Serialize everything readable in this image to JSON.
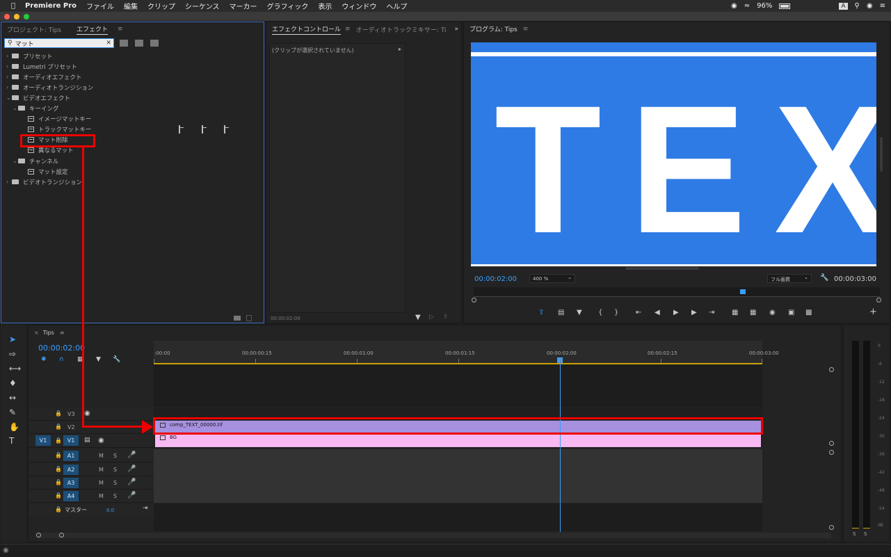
{
  "menubar": {
    "app": "Premiere Pro",
    "items": [
      "ファイル",
      "編集",
      "クリップ",
      "シーケンス",
      "マーカー",
      "グラフィック",
      "表示",
      "ウィンドウ",
      "ヘルプ"
    ],
    "battery": "96%",
    "input_badge": "A"
  },
  "effects_panel": {
    "tabs": [
      "プロジェクト: Tips",
      "エフェクト"
    ],
    "search_value": "マット",
    "tree": [
      {
        "label": "プリセット",
        "level": 0,
        "kind": "folder"
      },
      {
        "label": "Lumetri プリセット",
        "level": 0,
        "kind": "folder"
      },
      {
        "label": "オーディオエフェクト",
        "level": 0,
        "kind": "folder"
      },
      {
        "label": "オーディオトランジション",
        "level": 0,
        "kind": "folder"
      },
      {
        "label": "ビデオエフェクト",
        "level": 0,
        "kind": "folder",
        "open": true
      },
      {
        "label": "キーイング",
        "level": 1,
        "kind": "folder",
        "open": true
      },
      {
        "label": "イメージマットキー",
        "level": 2,
        "kind": "fx"
      },
      {
        "label": "トラックマットキー",
        "level": 2,
        "kind": "fx"
      },
      {
        "label": "マット削除",
        "level": 2,
        "kind": "fx"
      },
      {
        "label": "異なるマット",
        "level": 2,
        "kind": "fx"
      },
      {
        "label": "チャンネル",
        "level": 1,
        "kind": "folder",
        "open": true
      },
      {
        "label": "マット設定",
        "level": 2,
        "kind": "fx"
      },
      {
        "label": "ビデオトランジション",
        "level": 0,
        "kind": "folder"
      }
    ]
  },
  "effect_controls": {
    "tabs": [
      "エフェクトコントロール",
      "オーディオトラックミキサー: Ti"
    ],
    "empty_text": "(クリップが選択されていません)",
    "timecode": "00:00:02:00"
  },
  "program_monitor": {
    "title": "プログラム: Tips",
    "frame_text": "TEX",
    "frame_color": "#2f7be5",
    "timecode": "00:00:02:00",
    "zoom": "400 %",
    "quality": "フル画質",
    "duration": "00:00:03:00"
  },
  "timeline": {
    "sequence": "Tips",
    "timecode": "00:00:02:00",
    "ruler": [
      ":00:00",
      "00:00:00:15",
      "00:00:01:00",
      "00:00:01:15",
      "00:00:02:00",
      "00:00:02:15",
      "00:00:03:00"
    ],
    "video_tracks": [
      "V3",
      "V2",
      "V1"
    ],
    "audio_tracks": [
      "A1",
      "A2",
      "A3",
      "A4"
    ],
    "source_patch_video": "V1",
    "master_label": "マスター",
    "master_value": "0.0",
    "clips": {
      "v2": "comp_TEXT_00000.tif",
      "v1": "BG"
    },
    "audio_btn_m": "M",
    "audio_btn_s": "S"
  },
  "meters": {
    "labels": [
      "0",
      "-6",
      "-12",
      "-18",
      "-24",
      "-30",
      "-36",
      "-42",
      "-48",
      "-54",
      "dB"
    ],
    "solo_buttons": [
      "S",
      "S"
    ]
  }
}
